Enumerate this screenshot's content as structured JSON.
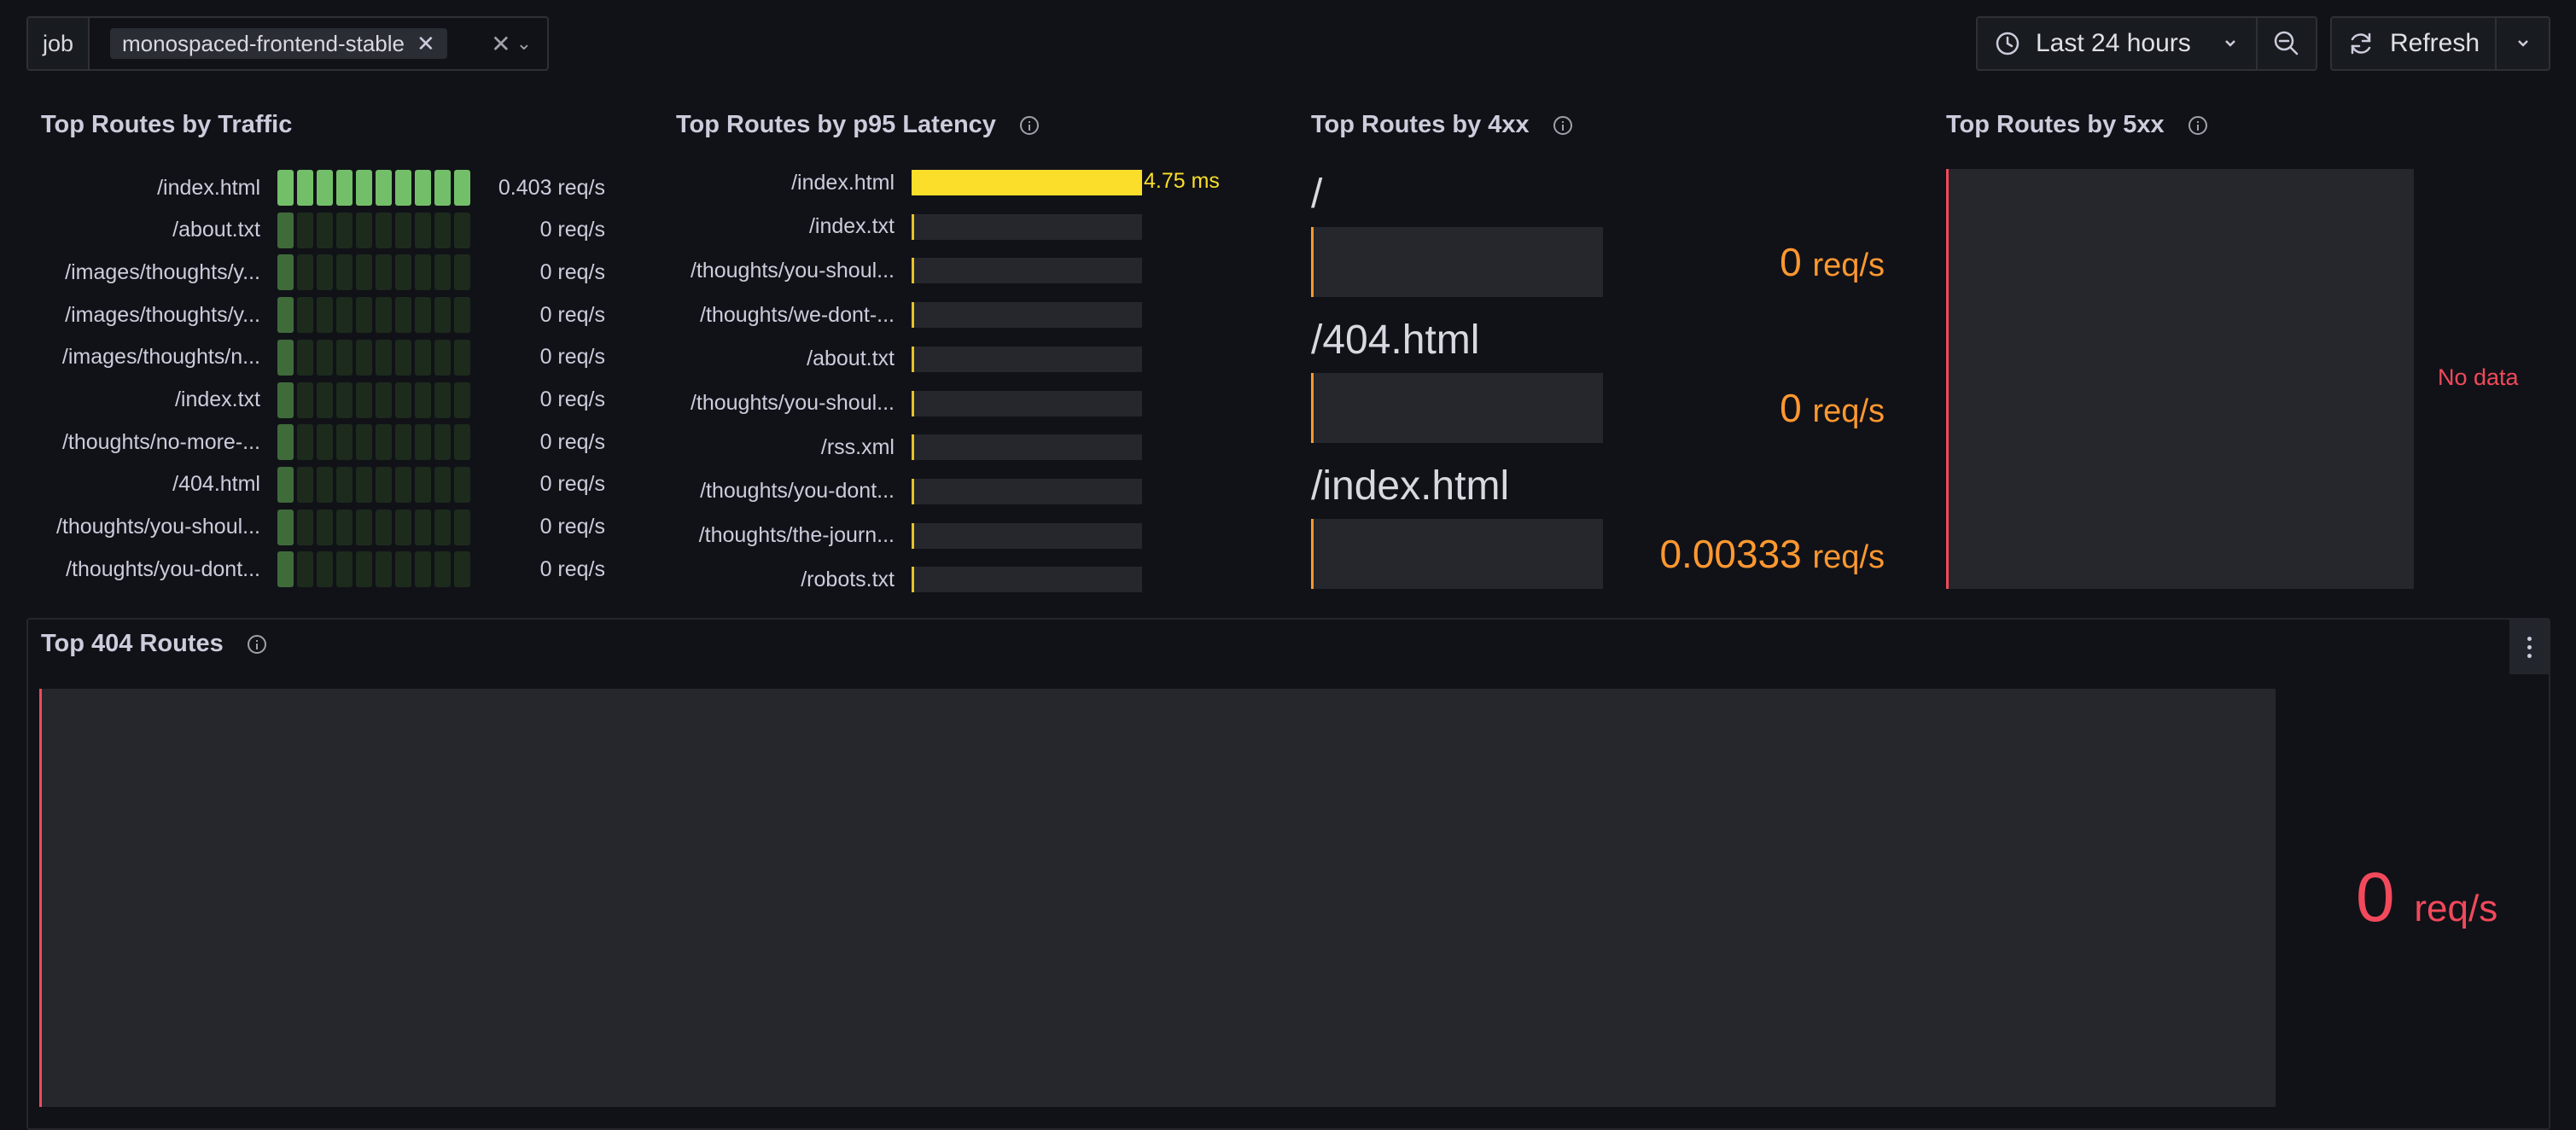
{
  "variable": {
    "label": "job",
    "value": "monospaced-frontend-stable"
  },
  "time_picker": {
    "label": "Last 24 hours"
  },
  "refresh": {
    "label": "Refresh"
  },
  "panels": {
    "traffic": {
      "title": "Top Routes by Traffic",
      "rows": [
        {
          "route": "/index.html",
          "value": "0.403 req/s",
          "level": 1.0
        },
        {
          "route": "/about.txt",
          "value": "0 req/s",
          "level": 0.0
        },
        {
          "route": "/images/thoughts/y...",
          "value": "0 req/s",
          "level": 0.0
        },
        {
          "route": "/images/thoughts/y...",
          "value": "0 req/s",
          "level": 0.0
        },
        {
          "route": "/images/thoughts/n...",
          "value": "0 req/s",
          "level": 0.0
        },
        {
          "route": "/index.txt",
          "value": "0 req/s",
          "level": 0.0
        },
        {
          "route": "/thoughts/no-more-...",
          "value": "0 req/s",
          "level": 0.0
        },
        {
          "route": "/404.html",
          "value": "0 req/s",
          "level": 0.0
        },
        {
          "route": "/thoughts/you-shoul...",
          "value": "0 req/s",
          "level": 0.0
        },
        {
          "route": "/thoughts/you-dont...",
          "value": "0 req/s",
          "level": 0.0
        }
      ]
    },
    "latency": {
      "title": "Top Routes by p95 Latency",
      "top_value": "4.75 ms",
      "rows": [
        {
          "route": "/index.html",
          "fraction": 1.0
        },
        {
          "route": "/index.txt",
          "fraction": 0.0
        },
        {
          "route": "/thoughts/you-shoul...",
          "fraction": 0.0
        },
        {
          "route": "/thoughts/we-dont-...",
          "fraction": 0.0
        },
        {
          "route": "/about.txt",
          "fraction": 0.0
        },
        {
          "route": "/thoughts/you-shoul...",
          "fraction": 0.0
        },
        {
          "route": "/rss.xml",
          "fraction": 0.0
        },
        {
          "route": "/thoughts/you-dont...",
          "fraction": 0.0
        },
        {
          "route": "/thoughts/the-journ...",
          "fraction": 0.0
        },
        {
          "route": "/robots.txt",
          "fraction": 0.0
        }
      ]
    },
    "status4xx": {
      "title": "Top Routes by 4xx",
      "stats": [
        {
          "route": "/",
          "value": "0",
          "unit": "req/s"
        },
        {
          "route": "/404.html",
          "value": "0",
          "unit": "req/s"
        },
        {
          "route": "/index.html",
          "value": "0.00333",
          "unit": "req/s"
        }
      ]
    },
    "status5xx": {
      "title": "Top Routes by 5xx",
      "empty_text": "No data"
    },
    "routes404": {
      "title": "Top 404 Routes",
      "value": "0",
      "unit": "req/s"
    }
  },
  "colors": {
    "background": "#111217",
    "green": "#73bf69",
    "yellow": "#fade2a",
    "orange": "#ff9830",
    "red": "#f2495c"
  }
}
